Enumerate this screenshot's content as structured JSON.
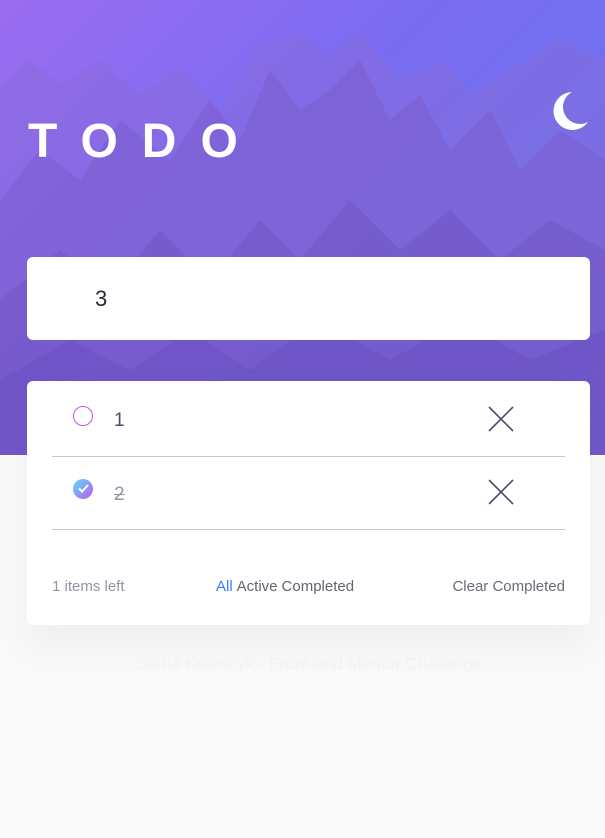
{
  "header": {
    "title": "TODO",
    "theme_toggle_icon": "moon-icon"
  },
  "new_todo": {
    "value": "3",
    "placeholder": ""
  },
  "todos": [
    {
      "text": "1",
      "completed": false
    },
    {
      "text": "2",
      "completed": true
    }
  ],
  "footer": {
    "items_left": "1 items left",
    "filters": [
      "All",
      "Active",
      "Completed"
    ],
    "active_filter": "All",
    "clear_label": "Clear Completed"
  },
  "attribution": "Diana Kolesnyk - Front-end Mentor Challenge",
  "colors": {
    "accent": "#3a7bfd",
    "gradient_start": "#57ddff",
    "gradient_end": "#c058f3",
    "page_bg": "#fafafa"
  }
}
